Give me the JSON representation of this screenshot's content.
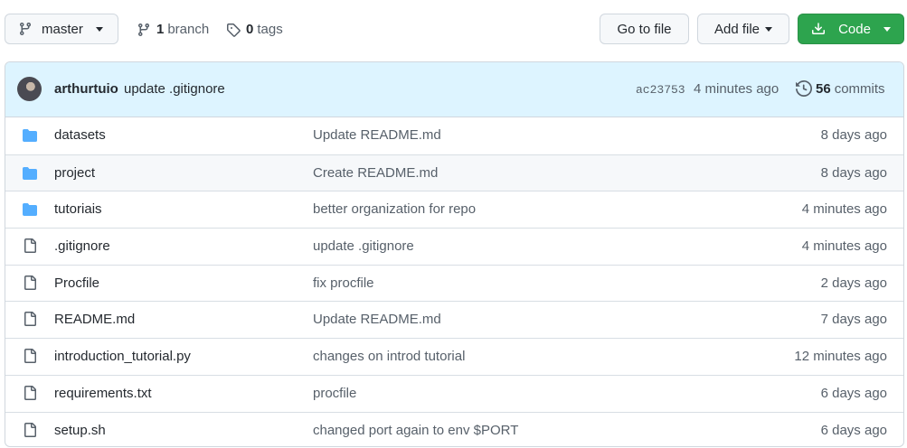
{
  "toolbar": {
    "branch_button_label": "master",
    "branches_count": "1",
    "branches_label": "branch",
    "tags_count": "0",
    "tags_label": "tags",
    "go_to_file_label": "Go to file",
    "add_file_label": "Add file",
    "code_label": "Code"
  },
  "latest_commit": {
    "author": "arthurtuio",
    "message": "update .gitignore",
    "sha": "ac23753",
    "time": "4 minutes ago",
    "commits_count": "56",
    "commits_label": "commits"
  },
  "files": [
    {
      "type": "folder-icon",
      "name": "datasets",
      "message": "Update README.md",
      "age": "8 days ago"
    },
    {
      "type": "folder-icon",
      "name": "project",
      "message": "Create README.md",
      "age": "8 days ago"
    },
    {
      "type": "folder-icon",
      "name": "tutoriais",
      "message": "better organization for repo",
      "age": "4 minutes ago"
    },
    {
      "type": "file-icon",
      "name": ".gitignore",
      "message": "update .gitignore",
      "age": "4 minutes ago"
    },
    {
      "type": "file-icon",
      "name": "Procfile",
      "message": "fix procfile",
      "age": "2 days ago"
    },
    {
      "type": "file-icon",
      "name": "README.md",
      "message": "Update README.md",
      "age": "7 days ago"
    },
    {
      "type": "file-icon",
      "name": "introduction_tutorial.py",
      "message": "changes on introd tutorial",
      "age": "12 minutes ago"
    },
    {
      "type": "file-icon",
      "name": "requirements.txt",
      "message": "procfile",
      "age": "6 days ago"
    },
    {
      "type": "file-icon",
      "name": "setup.sh",
      "message": "changed port again to env $PORT",
      "age": "6 days ago"
    }
  ],
  "colors": {
    "folder": "#54aeff",
    "code_button": "#2da44e",
    "commit_bar": "#ddf4ff"
  }
}
